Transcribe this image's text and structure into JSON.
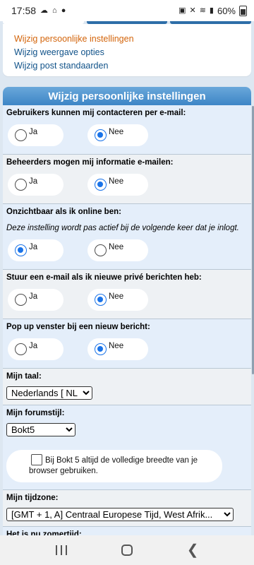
{
  "status": {
    "time": "17:58",
    "battery": "60%"
  },
  "nav_links": [
    {
      "label": "Wijzig persoonlijke instellingen"
    },
    {
      "label": "Wijzig weergave opties"
    },
    {
      "label": "Wijzig post standaarden"
    }
  ],
  "panel": {
    "title": "Wijzig persoonlijke instellingen",
    "settings": [
      {
        "label": "Gebruikers kunnen mij contacteren per e-mail:",
        "opt1": "Ja",
        "opt2": "Nee",
        "selected": "Nee"
      },
      {
        "label": "Beheerders mogen mij informatie e-mailen:",
        "opt1": "Ja",
        "opt2": "Nee",
        "selected": "Nee"
      },
      {
        "label": "Onzichtbaar als ik online ben:",
        "description": "Deze instelling wordt pas actief bij de volgende keer dat je inlogt.",
        "opt1": "Ja",
        "opt2": "Nee",
        "selected": "Ja"
      },
      {
        "label": "Stuur een e-mail als ik nieuwe privé berichten heb:",
        "opt1": "Ja",
        "opt2": "Nee",
        "selected": "Nee"
      },
      {
        "label": "Pop up venster bij een nieuw bericht:",
        "opt1": "Ja",
        "opt2": "Nee",
        "selected": "Nee"
      }
    ],
    "language": {
      "label": "Mijn taal:",
      "value": "Nederlands [ NL ]"
    },
    "forumstyle": {
      "label": "Mijn forumstijl:",
      "value": "Bokt5",
      "checkbox_text": "Bij Bokt 5 altijd de volledige breedte van je browser gebruiken.",
      "checked": false
    },
    "timezone": {
      "label": "Mijn tijdzone:",
      "value": "[GMT + 1, A] Centraal Europese Tijd, West Afrik..."
    },
    "next_label": "Het is nu zomertijd:"
  },
  "colors": {
    "link": "#105289",
    "link_active": "#d3640a",
    "header": "#3d85c6",
    "radio_selected": "#1a73e8"
  }
}
